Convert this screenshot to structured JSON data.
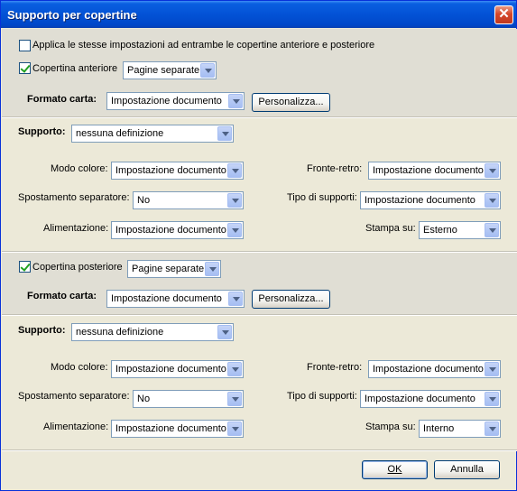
{
  "window": {
    "title": "Supporto per copertine"
  },
  "apply_both": {
    "label": "Applica le stesse impostazioni ad entrambe le copertine anteriore e posteriore",
    "checked": false
  },
  "front": {
    "cover_label": "Copertina anteriore",
    "cover_checked": true,
    "cover_mode": "Pagine separate",
    "paper_label": "Formato carta:",
    "paper_value": "Impostazione documento",
    "custom_button": "Personalizza...",
    "media_label": "Supporto:",
    "media_value": "nessuna definizione",
    "color_mode_label": "Modo colore:",
    "color_mode_value": "Impostazione documento",
    "duplex_label": "Fronte-retro:",
    "duplex_value": "Impostazione documento",
    "separator_label": "Spostamento separatore:",
    "separator_value": "No",
    "media_type_label": "Tipo di supporti:",
    "media_type_value": "Impostazione documento",
    "feed_label": "Alimentazione:",
    "feed_value": "Impostazione documento",
    "print_on_label": "Stampa su:",
    "print_on_value": "Esterno"
  },
  "back": {
    "cover_label": "Copertina posteriore",
    "cover_checked": true,
    "cover_mode": "Pagine separate",
    "paper_label": "Formato carta:",
    "paper_value": "Impostazione documento",
    "custom_button": "Personalizza...",
    "media_label": "Supporto:",
    "media_value": "nessuna definizione",
    "color_mode_label": "Modo colore:",
    "color_mode_value": "Impostazione documento",
    "duplex_label": "Fronte-retro:",
    "duplex_value": "Impostazione documento",
    "separator_label": "Spostamento separatore:",
    "separator_value": "No",
    "media_type_label": "Tipo di supporti:",
    "media_type_value": "Impostazione documento",
    "feed_label": "Alimentazione:",
    "feed_value": "Impostazione documento",
    "print_on_label": "Stampa su:",
    "print_on_value": "Interno"
  },
  "footer": {
    "ok_label": "OK",
    "cancel_label": "Annulla"
  },
  "colors": {
    "title_bar": "#0352d6",
    "dialog_bg": "#ece9d8",
    "gray_band": "#e0ded4",
    "close": "#d5472a"
  }
}
